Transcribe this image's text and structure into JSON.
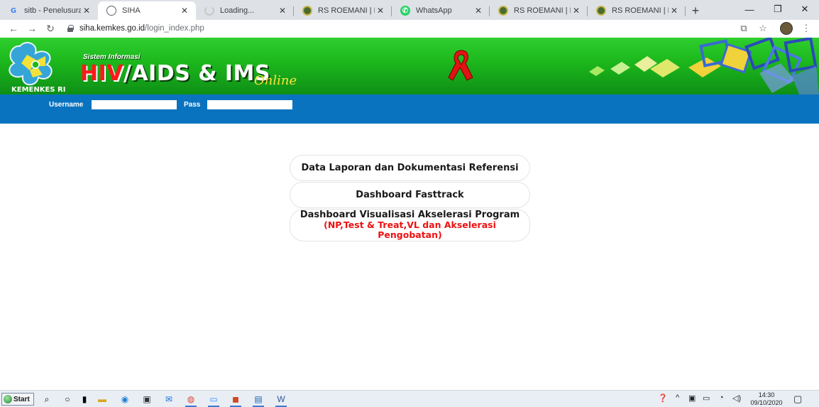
{
  "browser": {
    "tabs": [
      {
        "title": "sitb - Penelusuran",
        "favicon": "google-icon",
        "active": false
      },
      {
        "title": "SIHA",
        "favicon": "globe-icon",
        "active": true
      },
      {
        "title": "Loading...",
        "favicon": "loading-icon",
        "active": false
      },
      {
        "title": "RS ROEMANI | Mu",
        "favicon": "rs-roemani-icon",
        "active": false
      },
      {
        "title": "WhatsApp",
        "favicon": "whatsapp-icon",
        "active": false
      },
      {
        "title": "RS ROEMANI | Mu",
        "favicon": "rs-roemani-icon",
        "active": false
      },
      {
        "title": "RS ROEMANI | Mu",
        "favicon": "rs-roemani-icon",
        "active": false
      }
    ],
    "url_host": "siha.kemkes.go.id",
    "url_path": "/login_index.php"
  },
  "header": {
    "subtitle": "Sistem Informasi",
    "title_hiv": "HIV",
    "title_rest": "/AIDS & IMS",
    "online": "Online",
    "org": "KEMENKES RI",
    "colors": {
      "banner_green": "#1db91d",
      "login_blue": "#0a73bf",
      "hiv_red": "#ff1a1a",
      "online_yellow": "#ffe23a"
    }
  },
  "login": {
    "username_label": "Username",
    "username_value": "",
    "pass_label": "Pass",
    "pass_value": ""
  },
  "menu": {
    "btn1": "Data Laporan dan Dokumentasi Referensi",
    "btn2": "Dashboard Fasttrack",
    "btn3_line1": "Dashboard Visualisasi Akselerasi Program",
    "btn3_line2": "(NP,Test & Treat,VL dan Akselerasi",
    "btn3_line3": "Pengobatan)"
  },
  "taskbar": {
    "start_label": "Start",
    "time": "14:30",
    "date": "09/10/2020"
  }
}
